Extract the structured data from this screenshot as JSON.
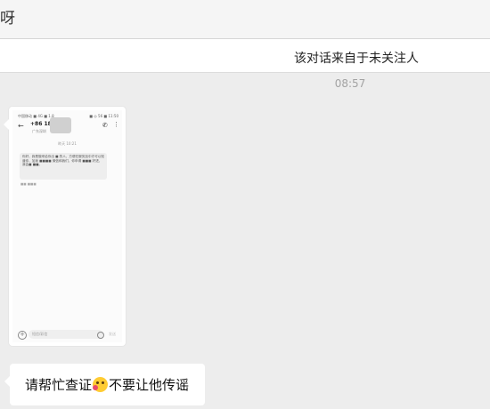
{
  "header": {
    "title": "呀"
  },
  "notice": {
    "text": "该对话来自于未关注人"
  },
  "timestamp": "08:57",
  "screenshot_message": {
    "status_left": "中国移动 ■ 4G ■ 1.8",
    "status_right": "■ ◎ 56 ■ 11:50",
    "number": "+86 18      137",
    "subtitle": "广东深圳",
    "date": "昨天 10:21",
    "msg_text": "你好，我是饿来给你出 ■ 的人，方便在服务加中才可以知道你，加我 ■■■■ 微信和我们，你申请 ■■■ 好进，我会■ ■■。",
    "meta": "■■ ■■■",
    "input_placeholder": "短信/彩信",
    "send_label": "发送"
  },
  "text_message": {
    "before_emoji": "请帮忙查证",
    "emoji": "kiss-heart-emoji",
    "after_emoji": "不要让他传谣"
  }
}
